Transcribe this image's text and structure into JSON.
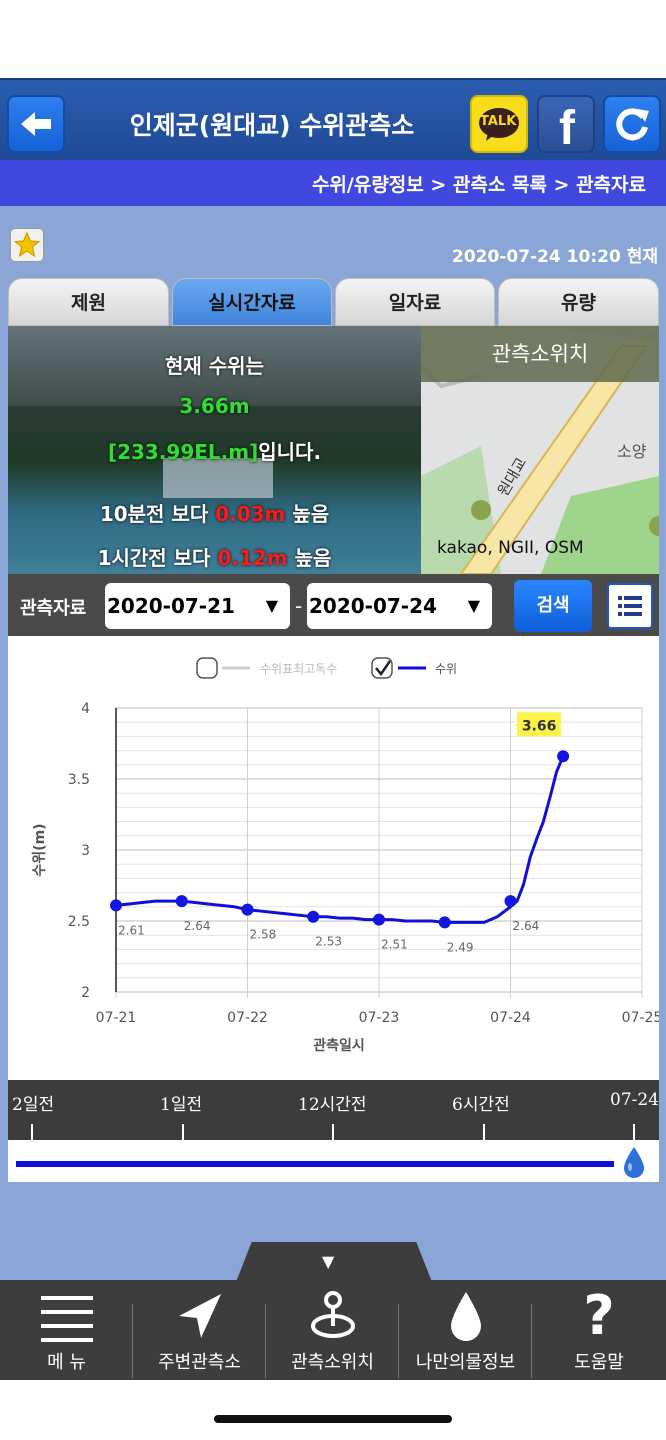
{
  "header": {
    "title": "인제군(원대교) 수위관측소",
    "talk_label": "TALK",
    "fb_label": "f"
  },
  "breadcrumb": "수위/유량정보 > 관측소 목록 > 관측자료",
  "datetime": "2020-07-24  10:20 현재",
  "tabs": [
    {
      "label": "제원",
      "active": false
    },
    {
      "label": "실시간자료",
      "active": true
    },
    {
      "label": "일자료",
      "active": false
    },
    {
      "label": "유량",
      "active": false
    }
  ],
  "status": {
    "line1": "현재 수위는",
    "level": "3.66m",
    "elevation": "[233.99EL.m]",
    "elevation_suffix": "입니다.",
    "change10_prefix": "10분전 보다",
    "change10_value": "0.03m",
    "change10_suffix": "높음",
    "change1h_prefix": "1시간전 보다",
    "change1h_value": "0.12m",
    "change1h_suffix": "높음"
  },
  "map": {
    "header": "관측소위치",
    "credit": "kakao, NGII, OSM",
    "place_label": "소양",
    "road_label": "원대교"
  },
  "search": {
    "label": "관측자료",
    "start_date": "2020-07-21",
    "end_date": "2020-07-24",
    "dash": "-",
    "button": "검색"
  },
  "chart_data": {
    "type": "line",
    "legend": [
      {
        "label": "수위표최고독수",
        "checked": false,
        "color": "#cccccc"
      },
      {
        "label": "수위",
        "checked": true,
        "color": "#1010d8"
      }
    ],
    "xlabel": "관측일시",
    "ylabel": "수위(m)",
    "xticks": [
      "07-21",
      "07-22",
      "07-23",
      "07-24",
      "07-25"
    ],
    "yticks": [
      "2",
      "2.5",
      "3",
      "3.5",
      "4"
    ],
    "ylim": [
      2,
      4
    ],
    "xlim": [
      0,
      4
    ],
    "series": [
      {
        "name": "수위",
        "x": [
          0,
          0.1,
          0.2,
          0.3,
          0.4,
          0.5,
          0.6,
          0.7,
          0.8,
          0.9,
          1.0,
          1.1,
          1.2,
          1.3,
          1.4,
          1.5,
          1.6,
          1.7,
          1.8,
          1.9,
          2.0,
          2.1,
          2.2,
          2.3,
          2.4,
          2.5,
          2.6,
          2.7,
          2.8,
          2.9,
          3.0,
          3.05,
          3.1,
          3.15,
          3.2,
          3.25,
          3.3,
          3.35,
          3.4
        ],
        "values": [
          2.61,
          2.62,
          2.63,
          2.64,
          2.64,
          2.64,
          2.63,
          2.62,
          2.61,
          2.6,
          2.58,
          2.57,
          2.56,
          2.55,
          2.54,
          2.53,
          2.53,
          2.52,
          2.52,
          2.51,
          2.51,
          2.51,
          2.5,
          2.5,
          2.5,
          2.49,
          2.49,
          2.49,
          2.49,
          2.53,
          2.6,
          2.64,
          2.76,
          2.95,
          3.08,
          3.2,
          3.37,
          3.55,
          3.66
        ]
      }
    ],
    "markers": [
      {
        "x": 0,
        "y": 2.61,
        "label": "2.61"
      },
      {
        "x": 0.5,
        "y": 2.64,
        "label": "2.64"
      },
      {
        "x": 1.0,
        "y": 2.58,
        "label": "2.58"
      },
      {
        "x": 1.5,
        "y": 2.53,
        "label": "2.53"
      },
      {
        "x": 2.0,
        "y": 2.51,
        "label": "2.51"
      },
      {
        "x": 2.5,
        "y": 2.49,
        "label": "2.49"
      },
      {
        "x": 3.0,
        "y": 2.64,
        "label": "2.64"
      },
      {
        "x": 3.4,
        "y": 3.66,
        "label": ""
      }
    ],
    "highlight": {
      "x": 3.4,
      "y": 3.66,
      "label": "3.66"
    },
    "grid": true
  },
  "timeline": {
    "labels": [
      "2일전",
      "1일전",
      "12시간전",
      "6시간전",
      "07-24"
    ],
    "position": 1.0
  },
  "nav": [
    {
      "label": "메 뉴",
      "icon": "menu-icon"
    },
    {
      "label": "주변관측소",
      "icon": "navigation-arrow-icon"
    },
    {
      "label": "관측소위치",
      "icon": "location-pin-icon"
    },
    {
      "label": "나만의물정보",
      "icon": "water-drop-icon"
    },
    {
      "label": "도움말",
      "icon": "help-icon"
    }
  ]
}
